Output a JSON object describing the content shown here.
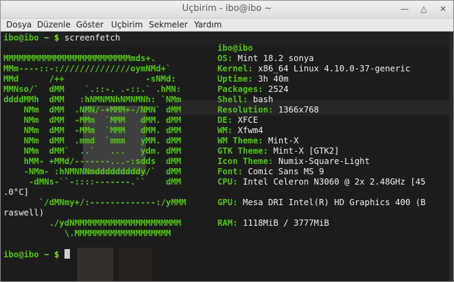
{
  "window": {
    "title": "Uçbirim - ibo@ibo ~",
    "buttons": [
      "minimize",
      "maximize",
      "close"
    ]
  },
  "menubar": {
    "items": [
      "Dosya",
      "Düzenle",
      "Göster",
      "Uçbirim",
      "Sekmeler",
      "Yardım"
    ]
  },
  "terminal": {
    "prompt_user": "ibo@ibo",
    "prompt_path": "~",
    "prompt_symbol": "$",
    "command": "screenfetch",
    "header": "ibo@ibo",
    "logo": [
      "MMMMMMMMMMMMMMMMMMMMMMMMMmds+.",
      "MMm----::-://////////////oymNMd+`",
      "MMd      /++                -sNMd:",
      "MMNso/`  dMM    `.::-. .-::.` .hMN:",
      "ddddMMh  dMM   :hNMNMNhNMNMNh: `NMm",
      "    NMm  dMM  .NMN/-+MMM+-/NMN` dMM",
      "    NMm  dMM  -MMm  `MMM   dMM. dMM",
      "    NMm  dMM  -MMm  `MMM   dMM. dMM",
      "    NMm  dMM  .mmd  `mmm   yMM. dMM",
      "    NMm  dMM`  ..`   ...   ydm. dMM",
      "    hMM- +MMd/-------...-:sdds  dMM",
      "    -NMm- :hNMNNNmdddddddddy/`  dMM",
      "     -dMNs-``-::::-------.``    dMM",
      "",
      "       `/dMNmy+/:-------------:/yMMM",
      "",
      "         ./ydNMMMMMMMMMMMMMMMMMMMMM",
      "            \\.MMMMMMMMMMMMMMMMMMM"
    ],
    "info": [
      {
        "key": "OS:",
        "value": "Mint 18.2 sonya"
      },
      {
        "key": "Kernel:",
        "value": "x86_64 Linux 4.10.0-37-generic"
      },
      {
        "key": "Uptime:",
        "value": "3h 40m"
      },
      {
        "key": "Packages:",
        "value": "2524"
      },
      {
        "key": "Shell:",
        "value": "bash"
      },
      {
        "key": "Resolution:",
        "value": "1366x768"
      },
      {
        "key": "DE:",
        "value": "XFCE"
      },
      {
        "key": "WM:",
        "value": "Xfwm4"
      },
      {
        "key": "WM Theme:",
        "value": "Mint-X"
      },
      {
        "key": "GTK Theme:",
        "value": "Mint-X [GTK2]"
      },
      {
        "key": "Icon Theme:",
        "value": "Numix-Square-Light"
      },
      {
        "key": "Font:",
        "value": "Comic Sans MS 9"
      },
      {
        "key": "CPU:",
        "value": "Intel Celeron N3060 @ 2x 2.48GHz [45"
      },
      {
        "key": "",
        "value": ".0°C]"
      },
      {
        "key": "GPU:",
        "value": "Mesa DRI Intel(R) HD Graphics 400 (B"
      },
      {
        "key": "",
        "value": "raswell)"
      },
      {
        "key": "RAM:",
        "value": "1118MiB / 3777MiB"
      }
    ]
  }
}
